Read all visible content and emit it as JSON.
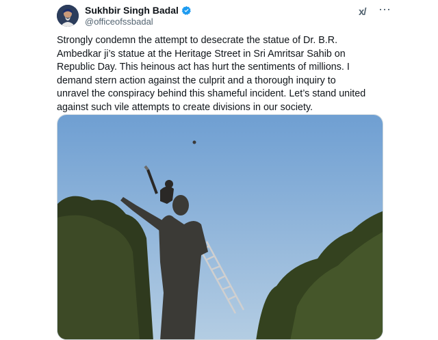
{
  "tweet": {
    "author_name": "Sukhbir Singh Badal",
    "author_handle": "@officeofssbadal",
    "grok_label": "x/",
    "more_label": "⋯",
    "text": "Strongly condemn the attempt to desecrate the statue of  Dr. B.R.\nAmbedkar ji’s statue at the Heritage Street in Sri Amritsar Sahib on\nRepublic Day. This heinous act has hurt the sentiments of millions. I\ndemand stern action against the culprit and a thorough inquiry to\nunravel the conspiracy behind this shameful incident. Let’s stand united\nagainst such vile attempts to create divisions in our society."
  },
  "colors": {
    "verified": "#1d9bf0",
    "text_primary": "#0f1419",
    "text_secondary": "#536471",
    "sky": "#7fa9d6"
  },
  "icons": {
    "verified": "verified-badge-icon",
    "grok": "grok-icon",
    "more": "more-options-icon"
  }
}
